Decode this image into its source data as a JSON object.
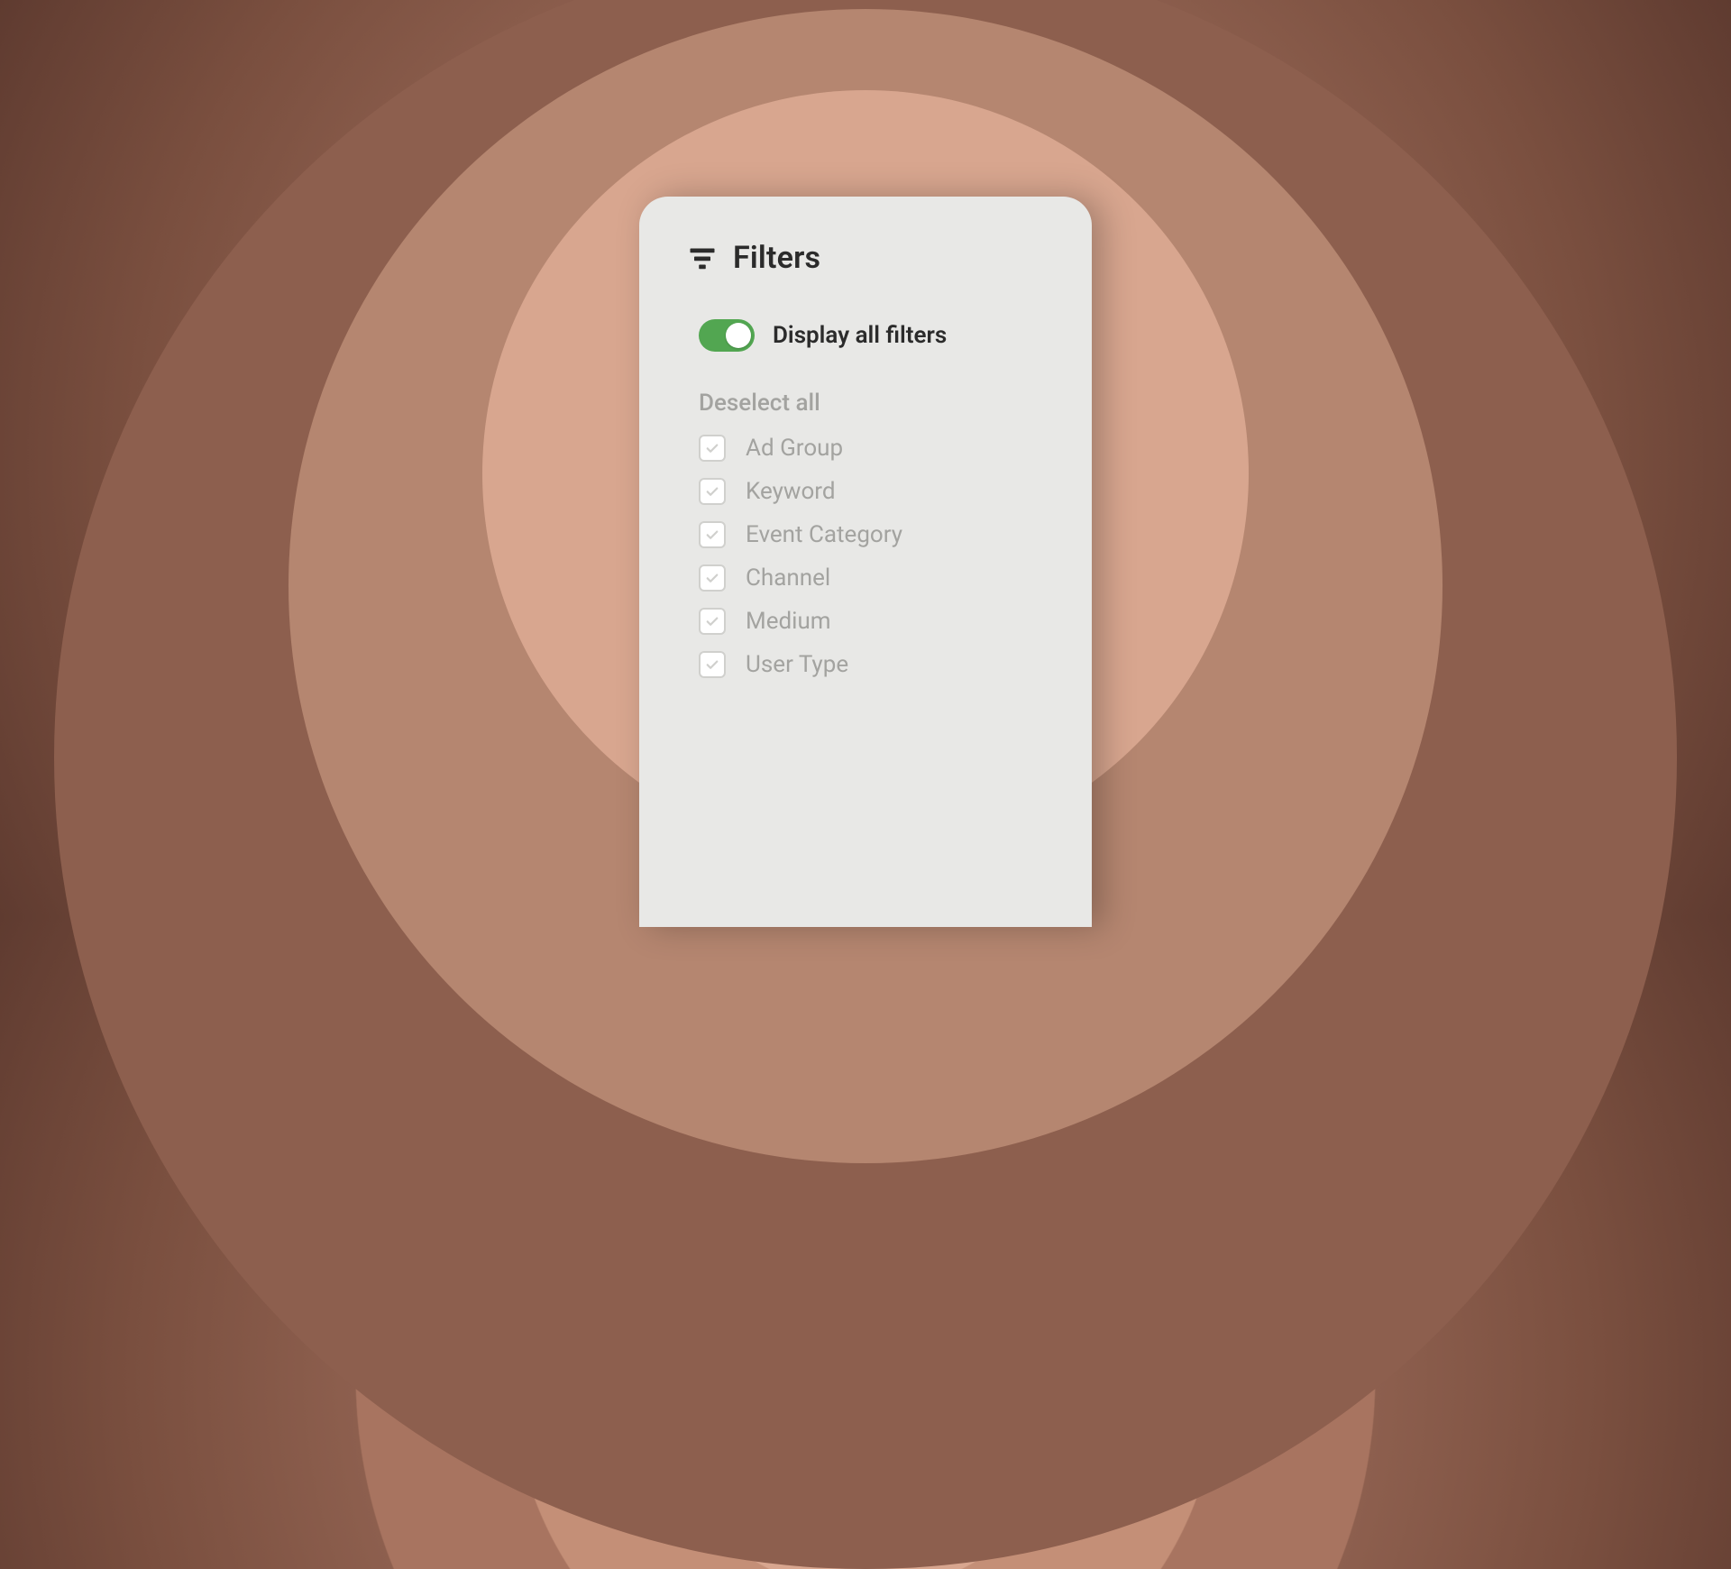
{
  "panel": {
    "title": "Filters",
    "toggle": {
      "label": "Display all filters",
      "state": "on"
    },
    "deselect_label": "Deselect all",
    "items": [
      {
        "label": "Ad Group",
        "checked": true
      },
      {
        "label": "Keyword",
        "checked": true
      },
      {
        "label": "Event Category",
        "checked": true
      },
      {
        "label": "Channel",
        "checked": true
      },
      {
        "label": "Medium",
        "checked": true
      },
      {
        "label": "User Type",
        "checked": true
      }
    ]
  },
  "colors": {
    "toggle_on": "#52a651",
    "panel_bg": "#e8e8e6",
    "text_primary": "#2b2b2b",
    "text_muted": "#a3a3a0"
  },
  "icons": {
    "filter": "filter-icon",
    "check": "check-icon"
  }
}
